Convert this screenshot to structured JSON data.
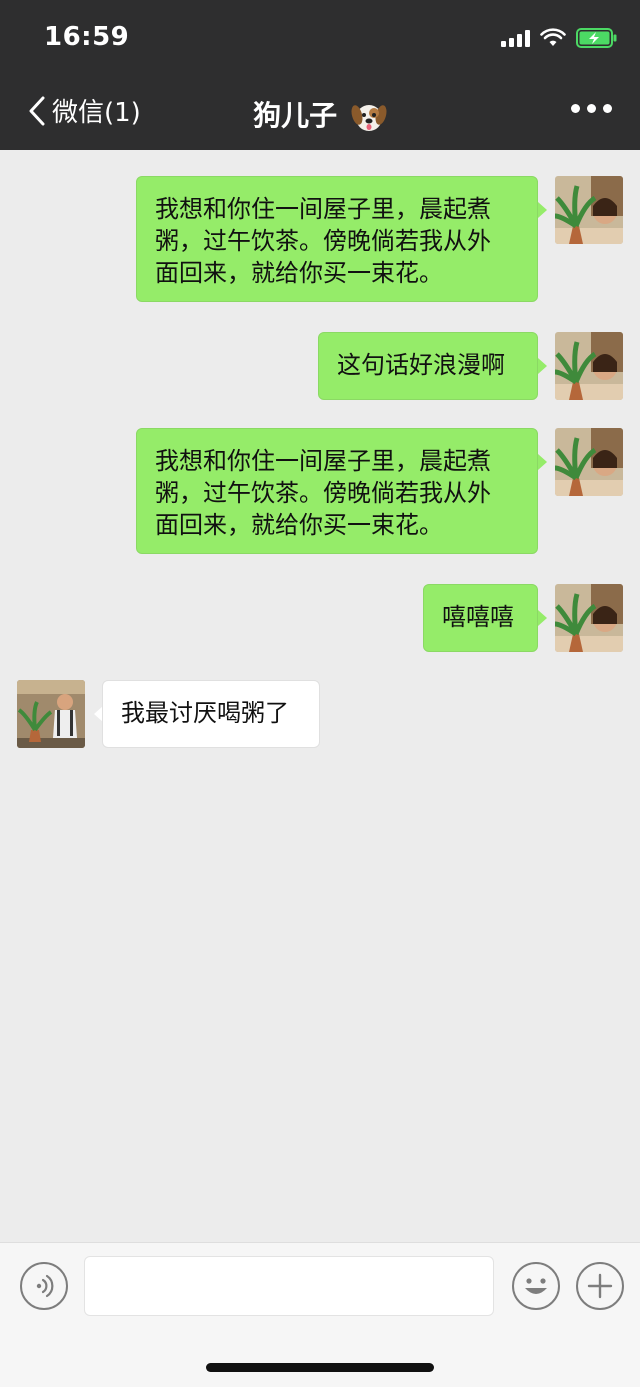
{
  "status_bar": {
    "time": "16:59"
  },
  "nav": {
    "back_label": "微信(1)",
    "title": "狗儿子",
    "title_emoji_icon": "dog-face-icon",
    "more_icon": "more-dots-icon"
  },
  "messages": [
    {
      "direction": "out",
      "text_lines": [
        "我想和你住一间屋子里，晨起煮",
        "粥，过午饮茶。傍晚倘若我从外",
        "面回来，就给你买一束花。"
      ]
    },
    {
      "direction": "out",
      "text": "这句话好浪漫啊"
    },
    {
      "direction": "out",
      "text_lines": [
        "我想和你住一间屋子里，晨起煮",
        "粥，过午饮茶。傍晚倘若我从外",
        "面回来，就给你买一束花。"
      ]
    },
    {
      "direction": "out",
      "text": "嘻嘻嘻"
    },
    {
      "direction": "in",
      "text": "我最讨厌喝粥了"
    }
  ],
  "input_bar": {
    "voice_icon": "voice-icon",
    "input_value": "",
    "emoji_icon": "emoji-icon",
    "plus_icon": "plus-icon"
  },
  "colors": {
    "header_bg": "#2e2e2f",
    "chat_bg": "#ececec",
    "bubble_out": "#95ec69",
    "bubble_in": "#ffffff",
    "battery_green": "#4cd964"
  }
}
